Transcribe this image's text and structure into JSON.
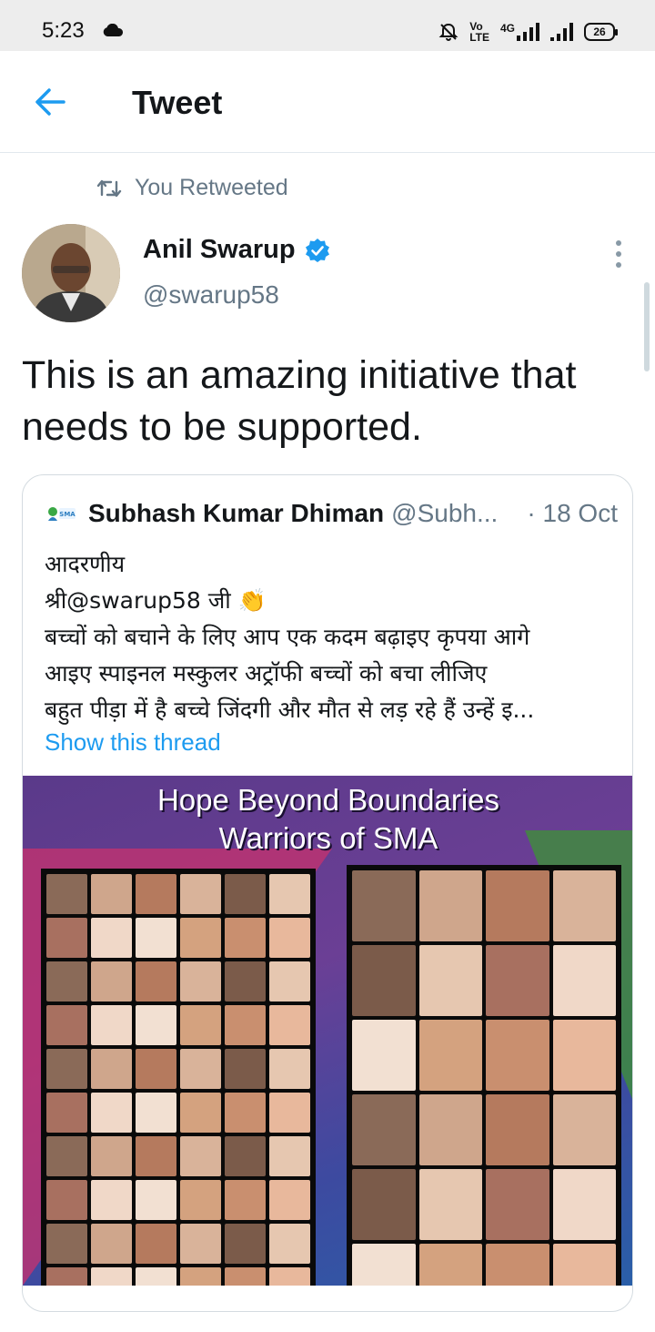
{
  "status_bar": {
    "time": "5:23",
    "volte": "Vo",
    "lte": "LTE",
    "network": "4G",
    "battery": "26"
  },
  "header": {
    "title": "Tweet"
  },
  "retweet": {
    "label": "You Retweeted"
  },
  "tweet": {
    "author_name": "Anil Swarup",
    "author_handle": "@swarup58",
    "verified": true,
    "text": "This is an amazing initiative that needs to be supported."
  },
  "quoted_tweet": {
    "author_name": "Subhash Kumar Dhiman",
    "author_handle": "@Subh...",
    "date": "· 18 Oct",
    "lines": [
      "आदरणीय",
      "श्री@swarup58 जी 👏",
      "बच्चों को बचाने के लिए आप एक कदम बढ़ाइए कृपया आगे",
      "आइए स्पाइनल मस्कुलर अट्रॉफी बच्चों को बचा लीजिए",
      "बहुत पीड़ा में है बच्चे जिंदगी और मौत से लड़ रहे हैं उन्हें इ..."
    ],
    "show_thread": "Show this thread",
    "image_title_line1": "Hope Beyond Boundaries",
    "image_title_line2": "Warriors of SMA"
  },
  "colors": {
    "accent": "#1d9bf0",
    "secondary_text": "#657786",
    "primary_text": "#14171a"
  },
  "icons": {
    "back": "arrow-left-icon",
    "retweet": "retweet-icon",
    "verified": "verified-badge-icon",
    "more": "more-vertical-icon",
    "cloud": "cloud-icon",
    "mute": "bell-off-icon"
  }
}
